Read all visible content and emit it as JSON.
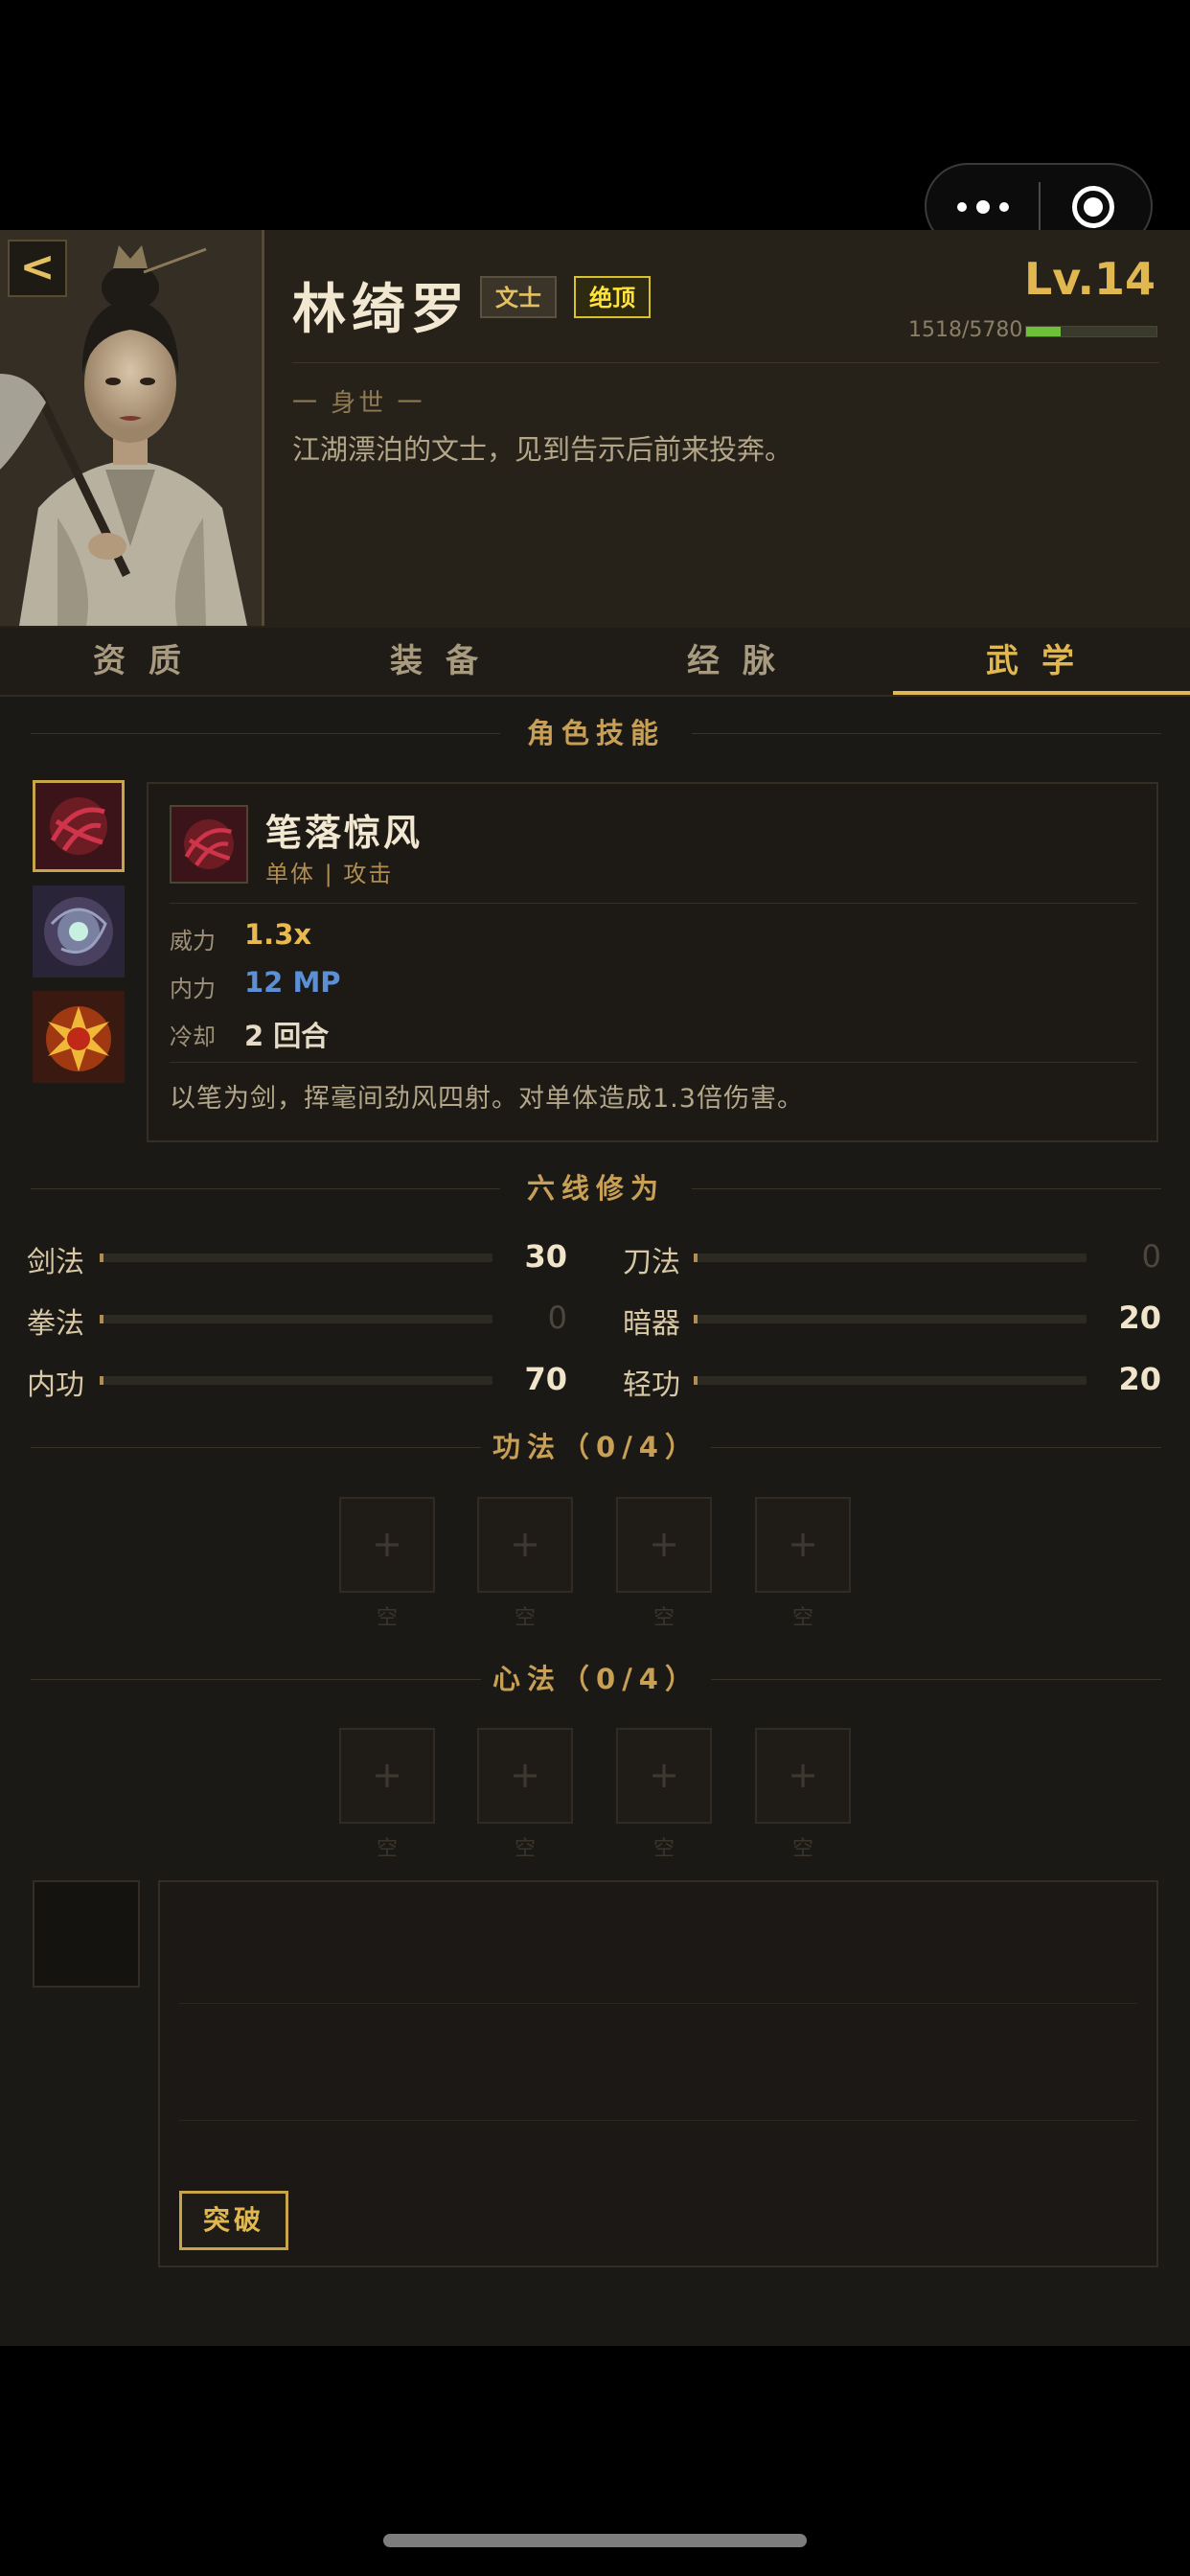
{
  "app": {
    "back_label": "<",
    "icons": {
      "more": "more-dots-icon",
      "close": "target-circle-icon"
    }
  },
  "character": {
    "name": "林绮罗",
    "class_tag": "文士",
    "rank_tag": "绝顶",
    "level": "Lv.14",
    "exp_text": "1518/5780",
    "exp_fraction": 0.263,
    "bio_title": "一 身世 一",
    "bio_text": "江湖漂泊的文士，见到告示后前来投奔。"
  },
  "tabs": [
    {
      "label": "资质",
      "active": false
    },
    {
      "label": "装备",
      "active": false
    },
    {
      "label": "经脉",
      "active": false
    },
    {
      "label": "武学",
      "active": true
    }
  ],
  "skills_section": {
    "title": "角色技能",
    "icons": [
      "crimson-claw-skill-icon",
      "vortex-skill-icon",
      "fire-burst-skill-icon"
    ],
    "selected": {
      "name": "笔落惊风",
      "type": "单体 | 攻击",
      "stats": [
        {
          "label": "威力",
          "value": "1.3x",
          "color": "#e9b94f"
        },
        {
          "label": "内力",
          "value": "12 MP",
          "color": "#5b8fd6"
        },
        {
          "label": "冷却",
          "value": "2 回合",
          "color": "#e6dcc6"
        }
      ],
      "description": "以笔为剑，挥毫间劲风四射。对单体造成1.3倍伤害。"
    }
  },
  "six_lines": {
    "title": "六线修为",
    "attributes": [
      {
        "label": "剑法",
        "value": "30"
      },
      {
        "label": "刀法",
        "value": "0"
      },
      {
        "label": "拳法",
        "value": "0"
      },
      {
        "label": "暗器",
        "value": "20"
      },
      {
        "label": "内功",
        "value": "70"
      },
      {
        "label": "轻功",
        "value": "20"
      }
    ]
  },
  "gongfa": {
    "title": "功法（0/4）",
    "slots": [
      {
        "symbol": "+",
        "caption": "空"
      },
      {
        "symbol": "+",
        "caption": "空"
      },
      {
        "symbol": "+",
        "caption": "空"
      },
      {
        "symbol": "+",
        "caption": "空"
      }
    ]
  },
  "xinfa": {
    "title": "心法（0/4）",
    "slots": [
      {
        "symbol": "+",
        "caption": "空"
      },
      {
        "symbol": "+",
        "caption": "空"
      },
      {
        "symbol": "+",
        "caption": "空"
      },
      {
        "symbol": "+",
        "caption": "空"
      }
    ]
  },
  "breakthrough": {
    "button_label": "突破"
  }
}
